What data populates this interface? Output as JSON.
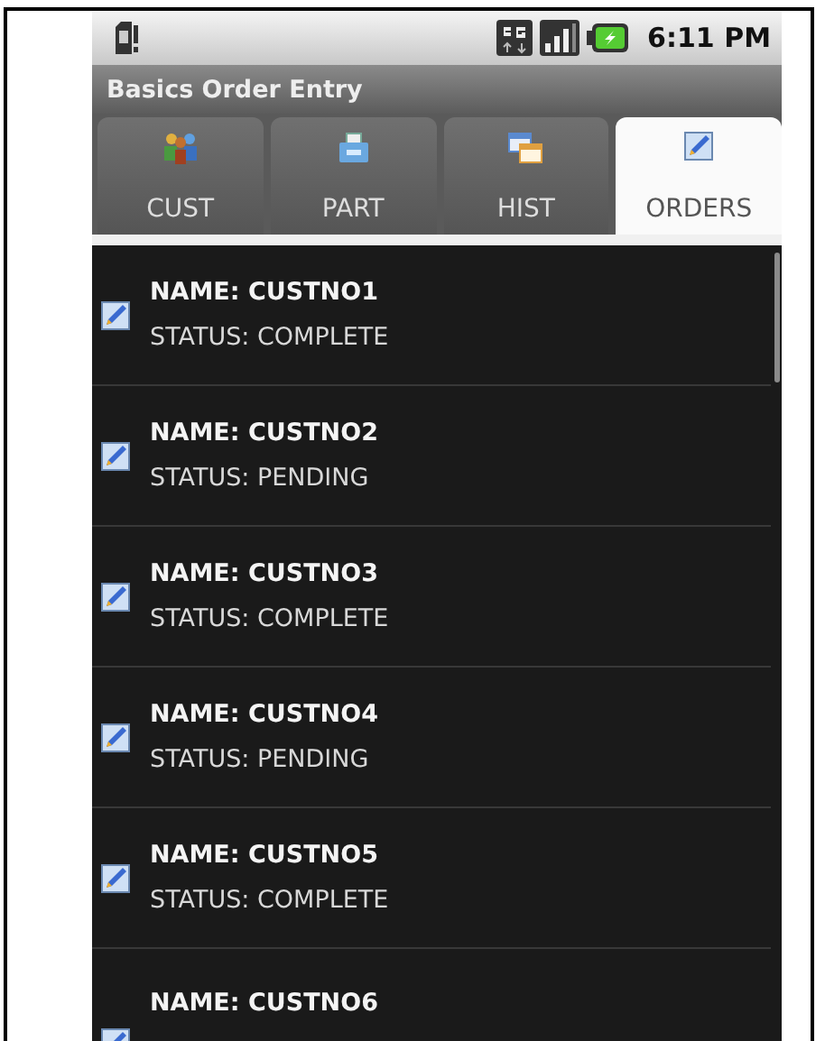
{
  "status_bar": {
    "time": "6:11 PM"
  },
  "title_bar": {
    "title": "Basics Order Entry"
  },
  "tabs": [
    {
      "label": "CUST",
      "kind": "people",
      "selected": false
    },
    {
      "label": "PART",
      "kind": "drawer",
      "selected": false
    },
    {
      "label": "HIST",
      "kind": "windows",
      "selected": false
    },
    {
      "label": "ORDERS",
      "kind": "edit",
      "selected": true
    }
  ],
  "orders": [
    {
      "name": "NAME: CUSTNO1",
      "status": "STATUS: COMPLETE"
    },
    {
      "name": "NAME: CUSTNO2",
      "status": "STATUS: PENDING"
    },
    {
      "name": "NAME: CUSTNO3",
      "status": "STATUS: COMPLETE"
    },
    {
      "name": "NAME: CUSTNO4",
      "status": "STATUS: PENDING"
    },
    {
      "name": "NAME: CUSTNO5",
      "status": "STATUS: COMPLETE"
    },
    {
      "name": "NAME: CUSTNO6"
    }
  ]
}
